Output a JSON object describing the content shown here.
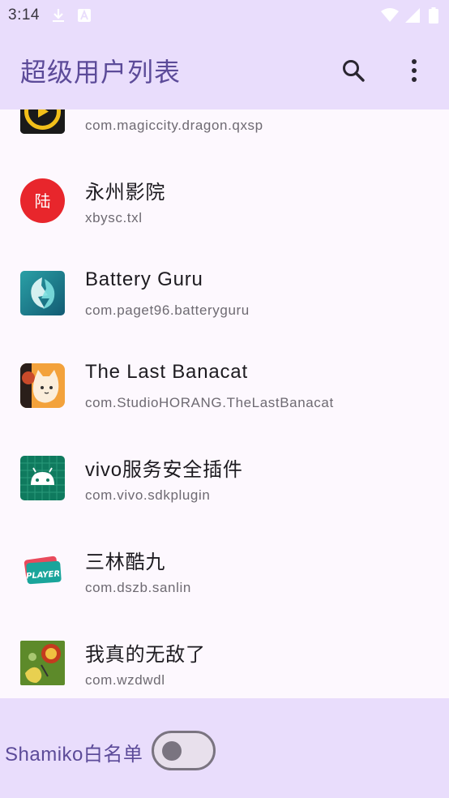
{
  "status_bar": {
    "time": "3:14",
    "icons": [
      "download-icon",
      "a-badge-icon",
      "wifi-icon",
      "signal-icon",
      "battery-icon"
    ]
  },
  "app_bar": {
    "title": "超级用户列表",
    "actions": [
      "search-icon",
      "more-vert-icon"
    ]
  },
  "apps": [
    {
      "name": "",
      "package": "com.magiccity.dragon.qxsp",
      "icon": "dragon-app-icon"
    },
    {
      "name": "永州影院",
      "package": "xbysc.txl",
      "icon": "yongzhou-cinema-icon",
      "icon_glyph": "陆"
    },
    {
      "name": "Battery Guru",
      "package": "com.paget96.batteryguru",
      "icon": "battery-guru-icon"
    },
    {
      "name": "The Last Banacat",
      "package": "com.StudioHORANG.TheLastBanacat",
      "icon": "banacat-icon"
    },
    {
      "name": "vivo服务安全插件",
      "package": "com.vivo.sdkplugin",
      "icon": "android-icon"
    },
    {
      "name": "三林酷九",
      "package": "com.dszb.sanlin",
      "icon": "player-icon",
      "icon_text": "PLAYER"
    },
    {
      "name": "我真的无敌了",
      "package": "com.wzdwdl",
      "icon": "game-icon"
    }
  ],
  "bottom": {
    "switch_label": "Shamiko白名单",
    "switch_on": false
  },
  "colors": {
    "bar_bg": "#e9ddfc",
    "accent": "#5c4b99",
    "list_bg": "#fdf8fe"
  }
}
